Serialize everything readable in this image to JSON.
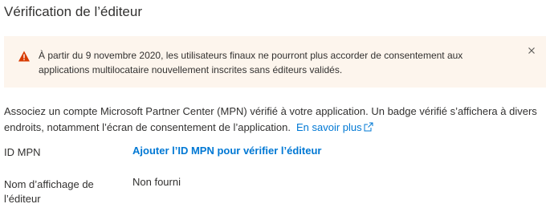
{
  "page": {
    "title": "Vérification de l’éditeur"
  },
  "banner": {
    "icon": "warning-icon",
    "message": "À partir du 9 novembre 2020, les utilisateurs finaux ne pourront plus accorder de consentement aux applications multilocataire nouvellement inscrites sans éditeurs validés.",
    "close_icon": "close-icon",
    "background": "#fdf5ed",
    "icon_color": "#d83b01"
  },
  "description": {
    "text": "Associez un compte Microsoft Partner Center (MPN) vérifié à votre application. Un badge vérifié s’affichera à divers endroits, notamment l’écran de consentement de l’application.",
    "learn_more_label": "En savoir plus",
    "learn_more_icon": "external-link-icon",
    "link_color": "#0078d4"
  },
  "fields": {
    "mpn_id": {
      "label": "ID MPN",
      "action_label": "Ajouter l’ID MPN pour vérifier l’éditeur"
    },
    "display_name": {
      "label": "Nom d’affichage de l’éditeur",
      "value": "Non fourni"
    }
  }
}
